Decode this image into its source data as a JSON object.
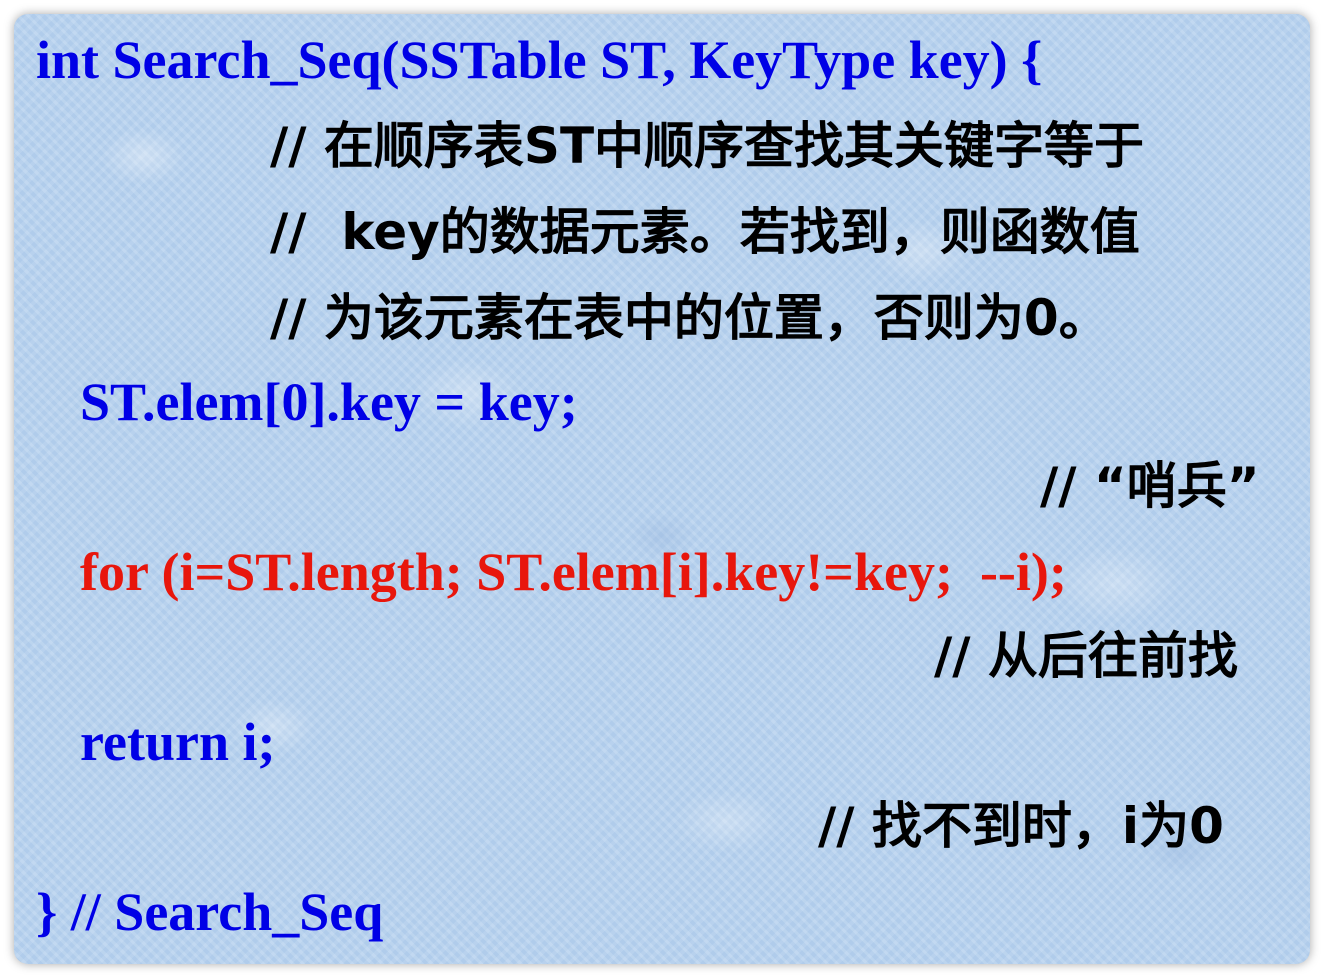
{
  "code": {
    "signature": "int Search_Seq(SSTable ST, KeyType key) {",
    "comment_line1": "// 在顺序表ST中顺序查找其关键字等于",
    "comment_line2": "//  key的数据元素。若找到，则函数值",
    "comment_line3": "// 为该元素在表中的位置，否则为0。",
    "sentinel_stmt": "ST.elem[0].key = key;",
    "sentinel_comment": "// “哨兵”",
    "for_stmt": "for (i=ST.length; ST.elem[i].key!=key;  --i);",
    "for_comment": "// 从后往前找",
    "return_stmt": "return i;",
    "return_comment": "// 找不到时，i为0",
    "closing": "} // Search_Seq"
  },
  "colors": {
    "code_blue": "#0000e6",
    "code_red": "#e8160c",
    "comment_black": "#000000",
    "background": "#b9d3ef"
  }
}
